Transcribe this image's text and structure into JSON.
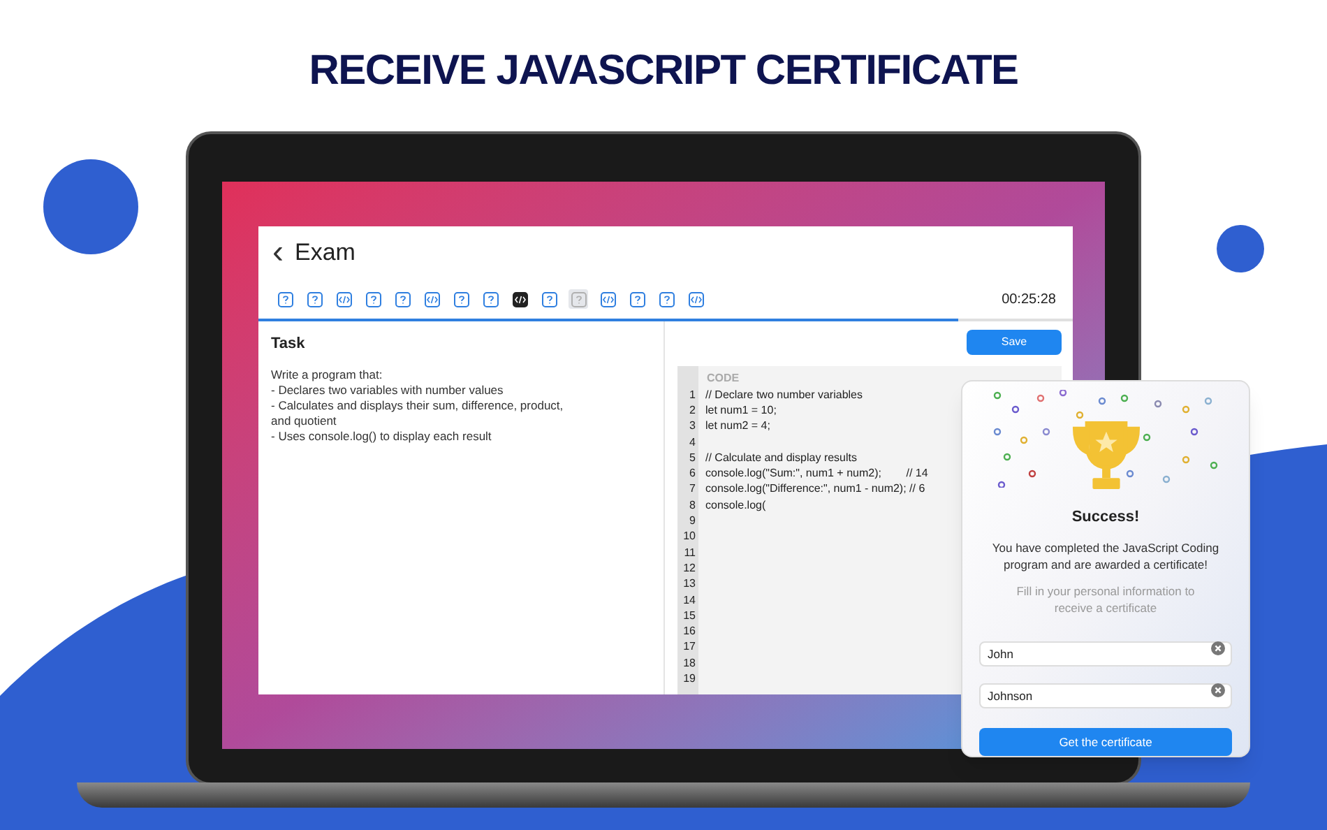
{
  "headline": "RECEIVE JAVASCRIPT CERTIFICATE",
  "exam": {
    "back_icon": "‹",
    "title": "Exam",
    "timer": "00:25:28",
    "progress": {
      "level": 0.86
    },
    "questions": [
      {
        "kind": "question",
        "selected": false,
        "highlighted": false
      },
      {
        "kind": "question",
        "selected": false,
        "highlighted": false
      },
      {
        "kind": "code",
        "selected": false,
        "highlighted": false
      },
      {
        "kind": "question",
        "selected": false,
        "highlighted": false
      },
      {
        "kind": "question",
        "selected": false,
        "highlighted": false
      },
      {
        "kind": "code",
        "selected": false,
        "highlighted": false
      },
      {
        "kind": "question",
        "selected": false,
        "highlighted": false
      },
      {
        "kind": "question",
        "selected": false,
        "highlighted": false
      },
      {
        "kind": "code",
        "selected": true,
        "highlighted": false
      },
      {
        "kind": "question",
        "selected": false,
        "highlighted": false
      },
      {
        "kind": "question",
        "selected": false,
        "highlighted": true
      },
      {
        "kind": "code",
        "selected": false,
        "highlighted": false
      },
      {
        "kind": "question",
        "selected": false,
        "highlighted": false
      },
      {
        "kind": "question",
        "selected": false,
        "highlighted": false
      },
      {
        "kind": "code",
        "selected": false,
        "highlighted": false
      }
    ],
    "task": {
      "heading": "Task",
      "lines": [
        "Write a program that:",
        "- Declares two variables with number values",
        "- Calculates and displays their sum, difference, product, and quotient",
        "- Uses console.log() to display each result"
      ]
    },
    "save_button": "Save",
    "editor": {
      "label": "CODE",
      "lines": [
        {
          "number": "1",
          "code": "// Declare two number variables"
        },
        {
          "number": "2",
          "code": "let num1 = 10;"
        },
        {
          "number": "3",
          "code": "let num2 = 4;"
        },
        {
          "number": "4"
        },
        {
          "number": "5",
          "code": "// Calculate and display results"
        },
        {
          "number": "6",
          "code": "console.log(\"Sum:\", num1 + num2);        // 14"
        },
        {
          "number": "7",
          "code": "console.log(\"Difference:\", num1 - num2); // 6"
        },
        {
          "number": "8",
          "code": "console.log("
        },
        {
          "number": "9"
        },
        {
          "number": "10"
        },
        {
          "number": "11"
        },
        {
          "number": "12"
        },
        {
          "number": "13"
        },
        {
          "number": "14"
        },
        {
          "number": "15"
        },
        {
          "number": "16"
        },
        {
          "number": "17"
        },
        {
          "number": "18"
        },
        {
          "number": "19"
        }
      ]
    }
  },
  "dialog": {
    "title": "Success!",
    "message": "You have completed the JavaScript Coding program and are awarded a certificate!",
    "hint": "Fill in your personal information to receive a certificate",
    "fields": [
      {
        "value": "John"
      },
      {
        "value": "Johnson"
      }
    ],
    "button": "Get the certificate"
  }
}
